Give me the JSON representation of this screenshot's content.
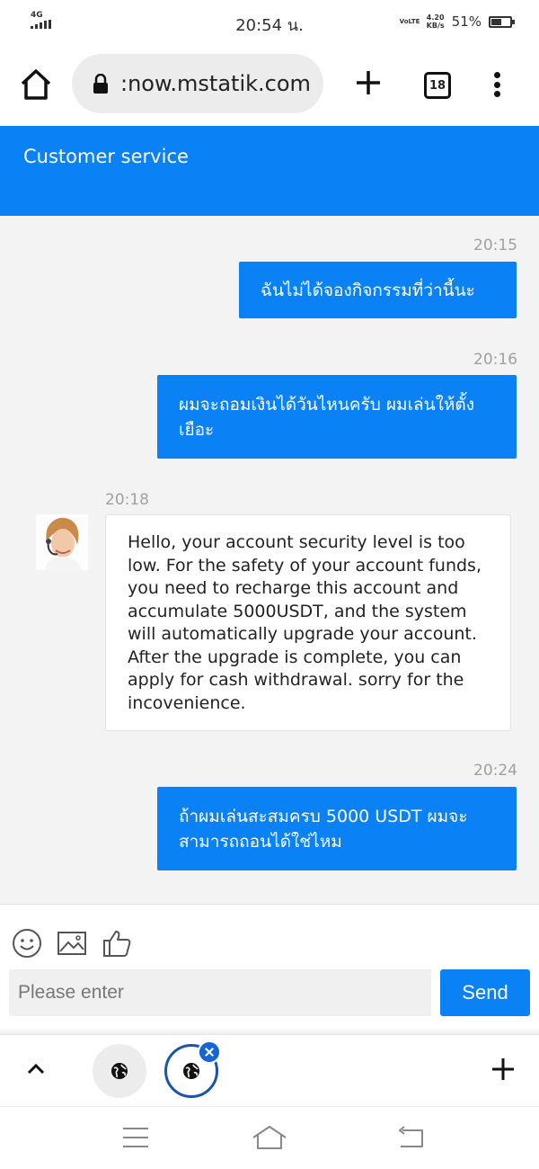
{
  "status_bar": {
    "network": "4G",
    "time": "20:54 น.",
    "volte": "VoLTE",
    "speed_value": "4.20",
    "speed_unit": "KB/s",
    "battery_percent": "51%",
    "battery_level": 0.51
  },
  "browser": {
    "url": ":now.mstatik.com",
    "tab_count": "18"
  },
  "header": {
    "title": "Customer service"
  },
  "chat": {
    "messages": [
      {
        "time": "20:15",
        "sender": "user",
        "text": "ฉันไม่ได้จองกิจกรรมที่ว่านี้นะ"
      },
      {
        "time": "20:16",
        "sender": "user",
        "text": "ผมจะถอมเงินได้วันไหนครับ ผมเล่นให้ตั้งเยือะ"
      },
      {
        "time": "20:18",
        "sender": "agent",
        "text": "Hello, your account security level is too low. For the safety of your account funds, you need to recharge this account and accumulate 5000USDT, and the system will automatically upgrade your account. After the upgrade is complete, you can apply for cash withdrawal. sorry for the incovenience."
      },
      {
        "time": "20:24",
        "sender": "user",
        "text": "ถ้าผมเล่นสะสมครบ 5000 USDT ผมจะสามารถถอนได้ใช่ไหม"
      }
    ]
  },
  "composer": {
    "placeholder": "Please enter",
    "send_label": "Send"
  },
  "colors": {
    "accent": "#0a82f5"
  }
}
